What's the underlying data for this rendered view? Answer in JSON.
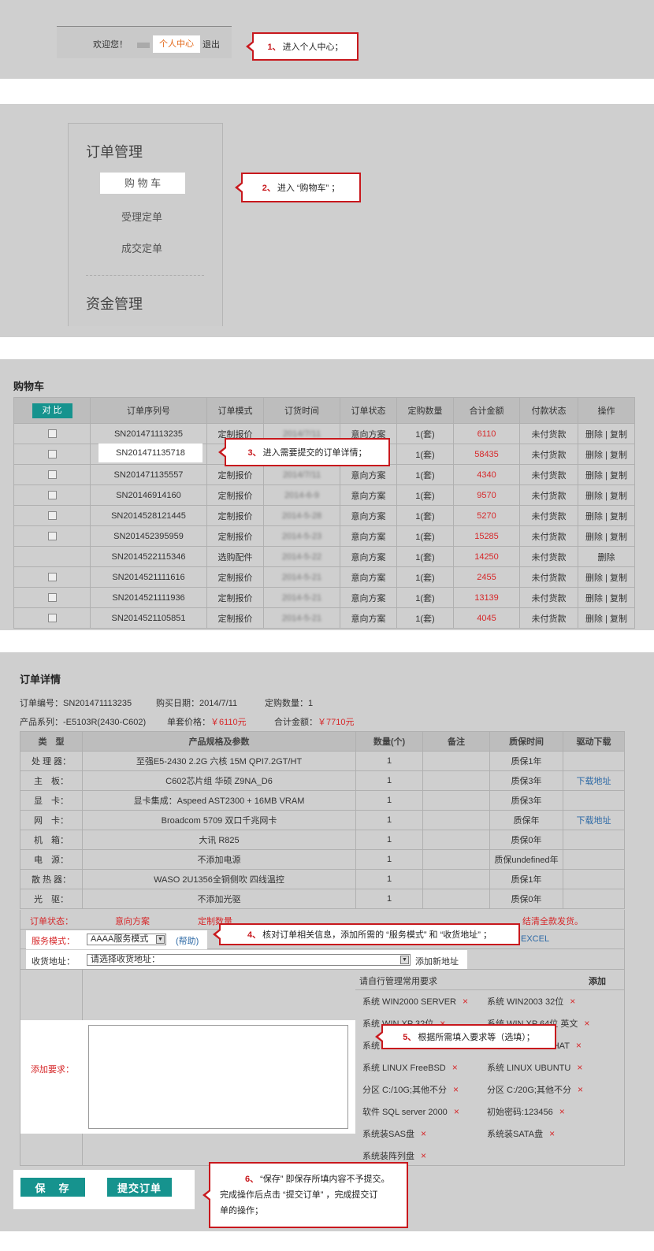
{
  "step1": {
    "welcome": "欢迎您！",
    "personal_center": "个人中心",
    "logout": "退出",
    "callout_num": "1、",
    "callout_text": "进入个人中心；"
  },
  "step2": {
    "menu_title": "订单管理",
    "items": [
      "购 物 车",
      "受理定单",
      "成交定单"
    ],
    "section2": "资金管理",
    "callout_num": "2、",
    "callout_text": "进入 “购物车” ；"
  },
  "cart": {
    "title": "购物车",
    "compare": "对 比",
    "headers": [
      "订单序列号",
      "订单模式",
      "订货时间",
      "订单状态",
      "定购数量",
      "合计金额",
      "付款状态",
      "操作"
    ],
    "rows": [
      {
        "sn": "SN201471113235",
        "mode": "定制报价",
        "time": "2014/7/11",
        "status": "意向方案",
        "qty": "1(套)",
        "amount": "6110",
        "pay": "未付货款",
        "ops": "删除 | 复制",
        "cb": true
      },
      {
        "sn": "SN201471135718",
        "mode": "",
        "time": "",
        "status": "",
        "qty": "1(套)",
        "amount": "58435",
        "pay": "未付货款",
        "ops": "删除 | 复制",
        "cb": true
      },
      {
        "sn": "SN201471135557",
        "mode": "定制报价",
        "time": "2014/7/11",
        "status": "意向方案",
        "qty": "1(套)",
        "amount": "4340",
        "pay": "未付货款",
        "ops": "删除 | 复制",
        "cb": true
      },
      {
        "sn": "SN20146914160",
        "mode": "定制报价",
        "time": "2014-6-9",
        "status": "意向方案",
        "qty": "1(套)",
        "amount": "9570",
        "pay": "未付货款",
        "ops": "删除 | 复制",
        "cb": true
      },
      {
        "sn": "SN2014528121445",
        "mode": "定制报价",
        "time": "2014-5-28",
        "status": "意向方案",
        "qty": "1(套)",
        "amount": "5270",
        "pay": "未付货款",
        "ops": "删除 | 复制",
        "cb": true
      },
      {
        "sn": "SN201452395959",
        "mode": "定制报价",
        "time": "2014-5-23",
        "status": "意向方案",
        "qty": "1(套)",
        "amount": "15285",
        "pay": "未付货款",
        "ops": "删除 | 复制",
        "cb": true
      },
      {
        "sn": "SN2014522115346",
        "mode": "选购配件",
        "time": "2014-5-22",
        "status": "意向方案",
        "qty": "1(套)",
        "amount": "14250",
        "pay": "未付货款",
        "ops": "删除",
        "cb": false
      },
      {
        "sn": "SN2014521111616",
        "mode": "定制报价",
        "time": "2014-5-21",
        "status": "意向方案",
        "qty": "1(套)",
        "amount": "2455",
        "pay": "未付货款",
        "ops": "删除 | 复制",
        "cb": true
      },
      {
        "sn": "SN2014521111936",
        "mode": "定制报价",
        "time": "2014-5-21",
        "status": "意向方案",
        "qty": "1(套)",
        "amount": "13139",
        "pay": "未付货款",
        "ops": "删除 | 复制",
        "cb": true
      },
      {
        "sn": "SN2014521105851",
        "mode": "定制报价",
        "time": "2014-5-21",
        "status": "意向方案",
        "qty": "1(套)",
        "amount": "4045",
        "pay": "未付货款",
        "ops": "删除 | 复制",
        "cb": true
      }
    ],
    "callout_num": "3、",
    "callout_text": "进入需要提交的订单详情；"
  },
  "detail": {
    "title": "订单详情",
    "order_no": "订单编号：SN201471113235",
    "buy_date": "购买日期：2014/7/11",
    "qty": "定购数量：1",
    "series": "产品系列：-E5103R(2430-C602)",
    "unit_label": "单套价格：",
    "unit_price": "￥6110元",
    "total_label": "合计金额：",
    "total_price": "￥7710元",
    "headers": [
      "类　型",
      "产品规格及参数",
      "数量(个)",
      "备注",
      "质保时间",
      "驱动下载"
    ],
    "rows": [
      {
        "type": "处 理 器：",
        "spec": "至强E5-2430 2.2G 六核 15M QPI7.2GT/HT",
        "qty": "1",
        "note": "",
        "warranty": "质保1年",
        "dl": ""
      },
      {
        "type": "主　板：",
        "spec": "C602芯片组 华硕 Z9NA_D6",
        "qty": "1",
        "note": "",
        "warranty": "质保3年",
        "dl": "下载地址"
      },
      {
        "type": "显　卡：",
        "spec": "显卡集成：Aspeed AST2300 + 16MB VRAM",
        "qty": "1",
        "note": "",
        "warranty": "质保3年",
        "dl": ""
      },
      {
        "type": "网　卡：",
        "spec": "Broadcom 5709 双口千兆网卡",
        "qty": "1",
        "note": "",
        "warranty": "质保年",
        "dl": "下载地址"
      },
      {
        "type": "机　箱：",
        "spec": "大讯 R825",
        "qty": "1",
        "note": "",
        "warranty": "质保0年",
        "dl": ""
      },
      {
        "type": "电　源：",
        "spec": "不添加电源",
        "qty": "1",
        "note": "",
        "warranty": "质保undefined年",
        "dl": ""
      },
      {
        "type": "散 热 器：",
        "spec": "WASO 2U1356全铜侧吹 四线温控",
        "qty": "1",
        "note": "",
        "warranty": "质保1年",
        "dl": ""
      },
      {
        "type": "光　驱：",
        "spec": "不添加光驱",
        "qty": "1",
        "note": "",
        "warranty": "质保0年",
        "dl": ""
      }
    ],
    "status_label": "订单状态：",
    "status_value": "意向方案",
    "status_mode": "定制数量",
    "status_tail": "结清全款发货。",
    "excel": "EXCEL",
    "service_label": "服务模式：",
    "service_value": "AAAA服务模式",
    "help": "(帮助)",
    "address_label": "收货地址：",
    "address_value": "请选择收货地址：",
    "add_address": "添加新地址",
    "req_header": "请自行管理常用要求",
    "req_add": "添加",
    "add_req_label": "添加要求：",
    "requirements": [
      "系统 WIN2000 SERVER",
      "系统 WIN2003 32位",
      "系统 WIN XP 32位",
      "系统 WIN XP 64位 英文",
      "系统 LINUX",
      "系统 LINUX REDHAT",
      "系统 LINUX FreeBSD",
      "系统 LINUX UBUNTU",
      "分区 C:/10G;其他不分",
      "分区 C:/20G;其他不分",
      "软件 SQL server 2000",
      "初始密码:123456",
      "系统装SAS盘",
      "系统装SATA盘",
      "系统装阵列盘"
    ],
    "save": "保　存",
    "submit": "提交订单",
    "callout4_num": "4、",
    "callout4_text": "核对订单相关信息，添加所需的 “服务模式” 和 “收货地址” ；",
    "callout5_num": "5、",
    "callout5_text": "根据所需填入要求等（选填）；",
    "callout6_num": "6、",
    "callout6_line1": "“保存” 即保存所填内容不予提交。",
    "callout6_line2": "完成操作后点击 “提交订单” ，完成提交订",
    "callout6_line3": "单的操作；"
  },
  "colors": {
    "accent": "#16938e",
    "red": "#d6282a",
    "callout_border": "#c8181d"
  }
}
